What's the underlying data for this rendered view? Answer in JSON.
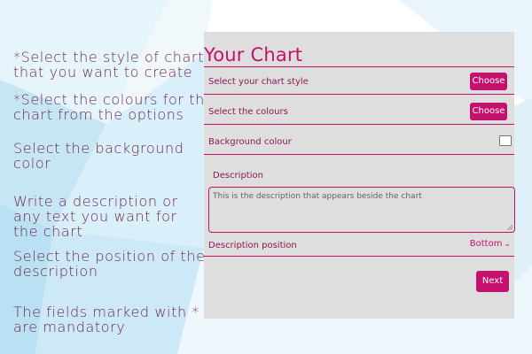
{
  "instructions": [
    {
      "id": "chart-style",
      "lines": [
        "*Select the style of chart",
        "that you want to create"
      ]
    },
    {
      "id": "colours",
      "lines": [
        "*Select the colours for the",
        "chart from the options"
      ]
    },
    {
      "id": "background",
      "lines": [
        "Select the background",
        "color"
      ]
    },
    {
      "id": "description",
      "lines": [
        "Write a description or",
        "any text you want for",
        "the chart"
      ]
    },
    {
      "id": "position",
      "lines": [
        "Select the position of the",
        "description"
      ]
    },
    {
      "id": "mandatory",
      "lines": [
        "The fields marked with *",
        "are mandatory"
      ]
    }
  ],
  "form": {
    "title": "Your Chart",
    "chart_style_label": "Select your chart style",
    "chart_style_button": "Choose",
    "colours_label": "Select the colours",
    "colours_button": "Choose",
    "background_label": "Background colour",
    "description_label": "Description",
    "description_value": "This is the description that appears beside the chart",
    "description_position_label": "Description position",
    "description_position_value": "Bottom",
    "next_button": "Next"
  },
  "colors": {
    "accent": "#c4116d",
    "panel_bg": "#dedede",
    "instruction_text": "#6a2a48"
  }
}
